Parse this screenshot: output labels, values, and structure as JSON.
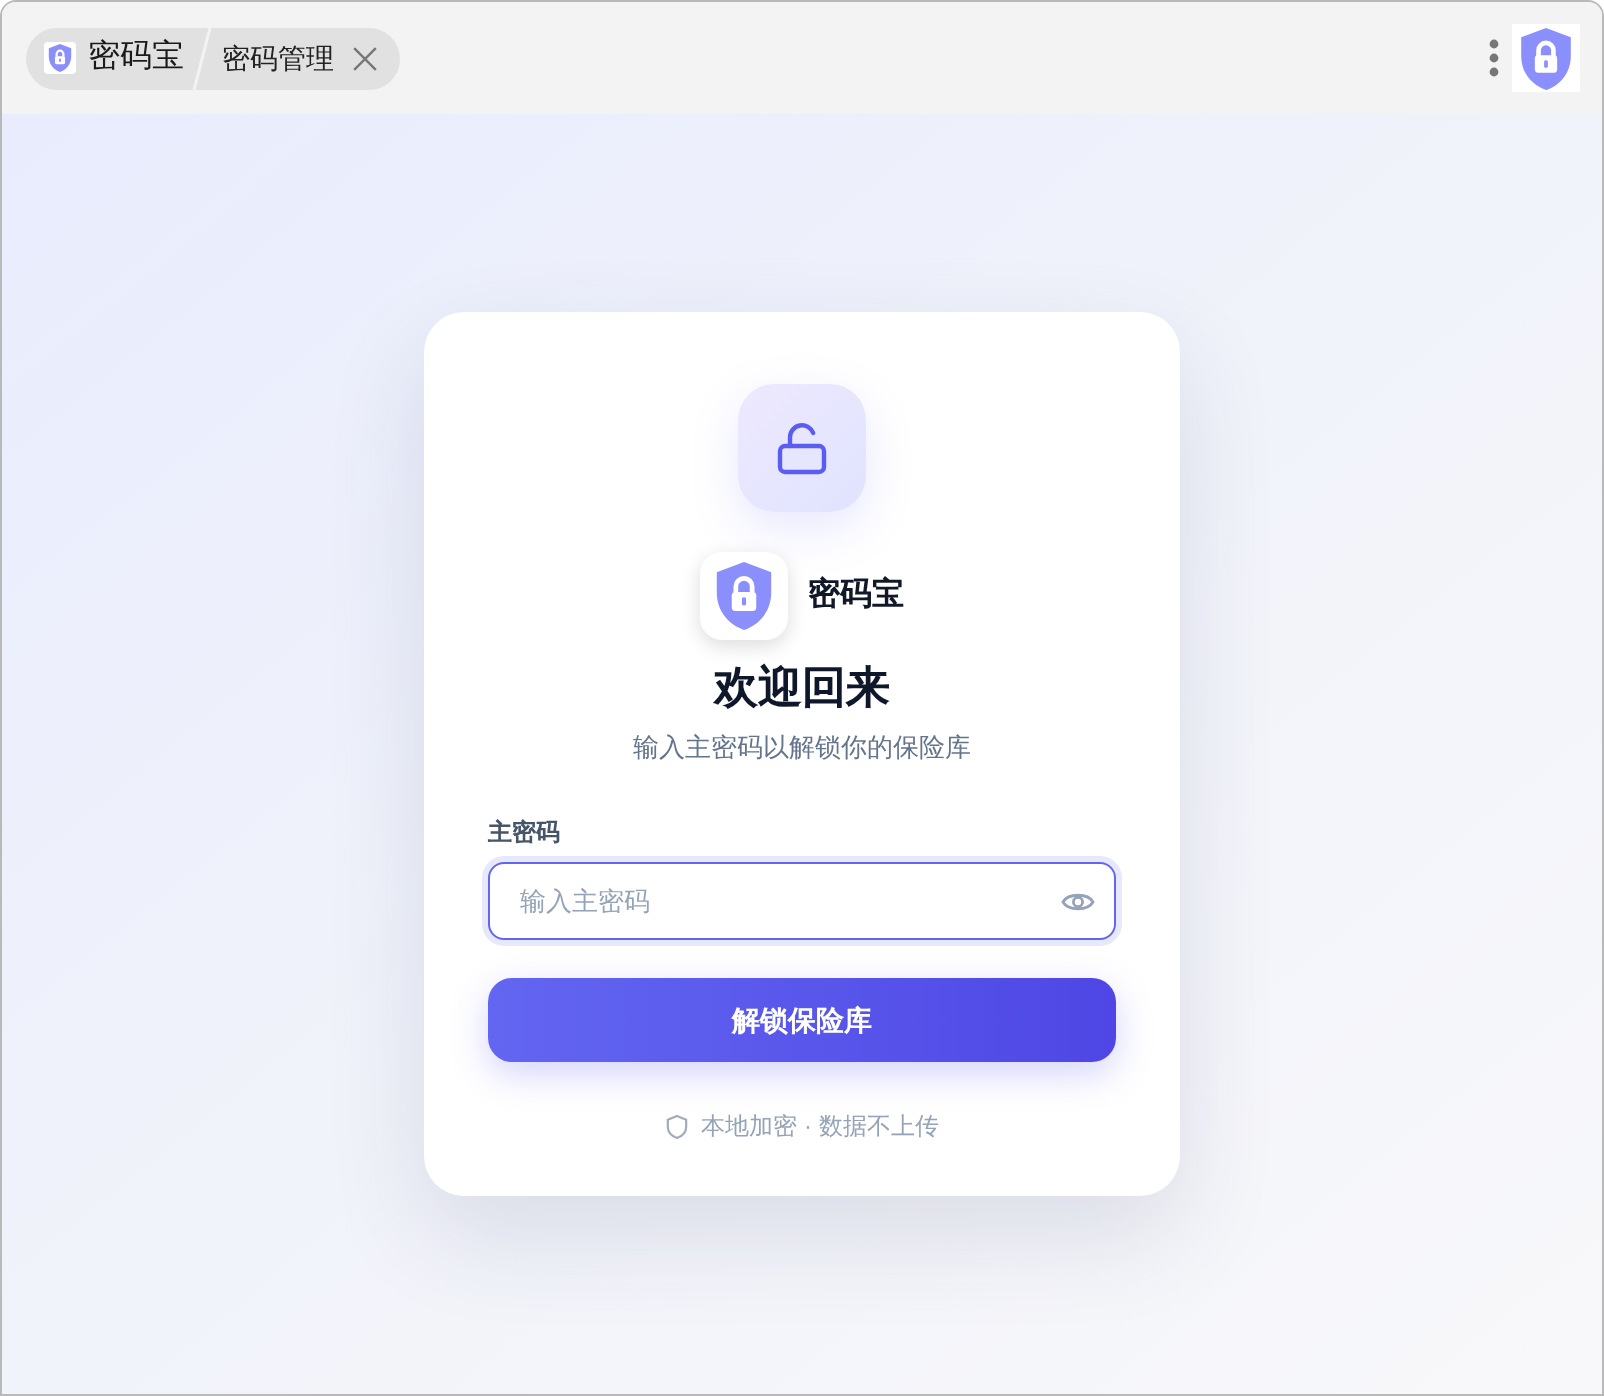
{
  "title_bar": {
    "app_tab": {
      "label": "密码宝"
    },
    "page_tab": {
      "label": "密码管理"
    }
  },
  "unlock_card": {
    "brand": "密码宝",
    "title": "欢迎回来",
    "subtitle": "输入主密码以解锁你的保险库",
    "password_field": {
      "label": "主密码",
      "placeholder": "输入主密码",
      "focused": true
    },
    "unlock_button": {
      "label": "解锁保险库"
    },
    "footer_note": "本地加密 · 数据不上传"
  }
}
